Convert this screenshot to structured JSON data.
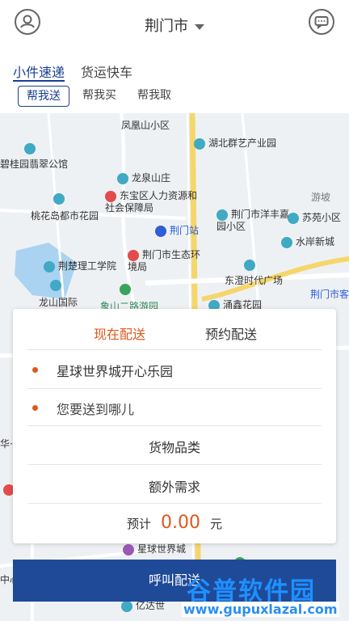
{
  "header": {
    "city": "荆门市"
  },
  "tabs": {
    "primary": [
      "小件速递",
      "货运快车"
    ],
    "chips": [
      "帮我送",
      "帮我买",
      "帮我取"
    ]
  },
  "map": {
    "pois": [
      "凤凰山小区",
      "湖北群艺产业园",
      "碧桂园翡翠公馆",
      "龙泉山庄",
      "东宝区人力资源和社会保障局",
      "游坡",
      "桃花岛都市花园",
      "荆门站",
      "荆门市洋丰嘉园小区",
      "苏苑小区",
      "水岸新城",
      "荆楚理工学院",
      "荆门市生态环境局",
      "东澄时代广场",
      "龙山国际",
      "象山二路游园",
      "涌鑫花园",
      "荆门市客",
      "星球世界城",
      "亿达世",
      "华·",
      "中心"
    ]
  },
  "card": {
    "mode_now": "现在配送",
    "mode_scheduled": "预约配送",
    "from_address": "星球世界城开心乐园",
    "to_placeholder": "您要送到哪儿",
    "goods_type": "货物品类",
    "extra_requirements": "额外需求",
    "estimate_label": "预计",
    "estimate_value": "0.00",
    "currency_unit": "元"
  },
  "bottom": {
    "call_button": "呼叫配送"
  },
  "watermark": {
    "logo": "谷普软件园",
    "url": "www.gupuxlazal.com"
  },
  "colors": {
    "brand_blue": "#1f4a98",
    "accent_orange": "#e0561e"
  }
}
